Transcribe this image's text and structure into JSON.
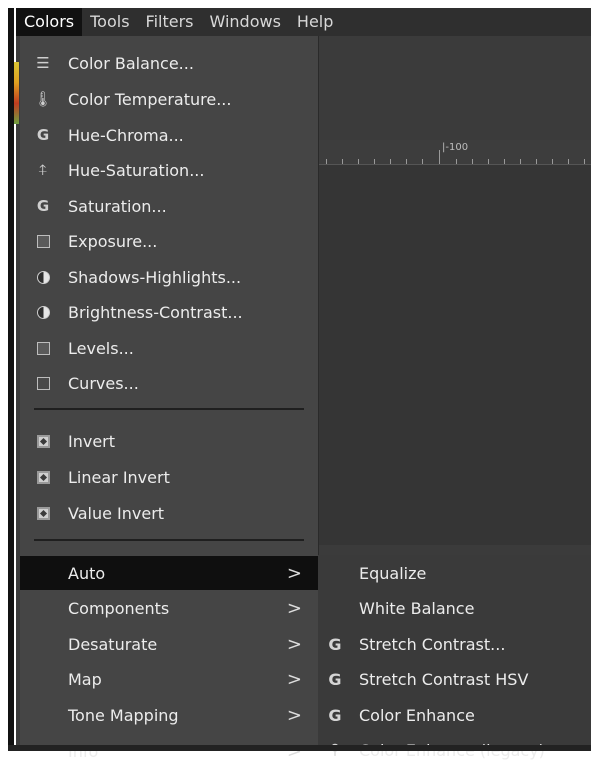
{
  "menubar": {
    "items": [
      "Colors",
      "Tools",
      "Filters",
      "Windows",
      "Help"
    ],
    "active_index": 0
  },
  "ruler": {
    "label": "|-100"
  },
  "colors_menu": {
    "items": [
      {
        "label": "Color Balance...",
        "icon": "color-balance-icon"
      },
      {
        "label": "Color Temperature...",
        "icon": "color-temperature-icon"
      },
      {
        "label": "Hue-Chroma...",
        "icon": "gegl-icon"
      },
      {
        "label": "Hue-Saturation...",
        "icon": "hue-saturation-icon"
      },
      {
        "label": "Saturation...",
        "icon": "gegl-icon"
      },
      {
        "label": "Exposure...",
        "icon": "exposure-icon"
      },
      {
        "label": "Shadows-Highlights...",
        "icon": "shadows-highlights-icon"
      },
      {
        "label": "Brightness-Contrast...",
        "icon": "brightness-contrast-icon"
      },
      {
        "label": "Levels...",
        "icon": "levels-icon"
      },
      {
        "label": "Curves...",
        "icon": "curves-icon"
      },
      {
        "label": "Invert",
        "icon": "invert-icon"
      },
      {
        "label": "Linear Invert",
        "icon": "invert-icon"
      },
      {
        "label": "Value Invert",
        "icon": "invert-icon"
      },
      {
        "label": "Auto",
        "submenu": true,
        "active": true
      },
      {
        "label": "Components",
        "submenu": true
      },
      {
        "label": "Desaturate",
        "submenu": true
      },
      {
        "label": "Map",
        "submenu": true
      },
      {
        "label": "Tone Mapping",
        "submenu": true
      },
      {
        "label": "Info",
        "submenu": true
      }
    ],
    "submenu_arrow": ">"
  },
  "auto_submenu": {
    "items": [
      {
        "label": "Equalize",
        "icon": ""
      },
      {
        "label": "White Balance",
        "icon": ""
      },
      {
        "label": "Stretch Contrast...",
        "icon": "gegl-icon"
      },
      {
        "label": "Stretch Contrast HSV",
        "icon": "gegl-icon"
      },
      {
        "label": "Color Enhance",
        "icon": "gegl-icon"
      },
      {
        "label": "Color Enhance (legacy)",
        "icon": "plugin-icon"
      }
    ]
  },
  "colors": {
    "menu_bg": "#454545",
    "active_bg": "#0f0f0f",
    "text": "#ececec"
  }
}
